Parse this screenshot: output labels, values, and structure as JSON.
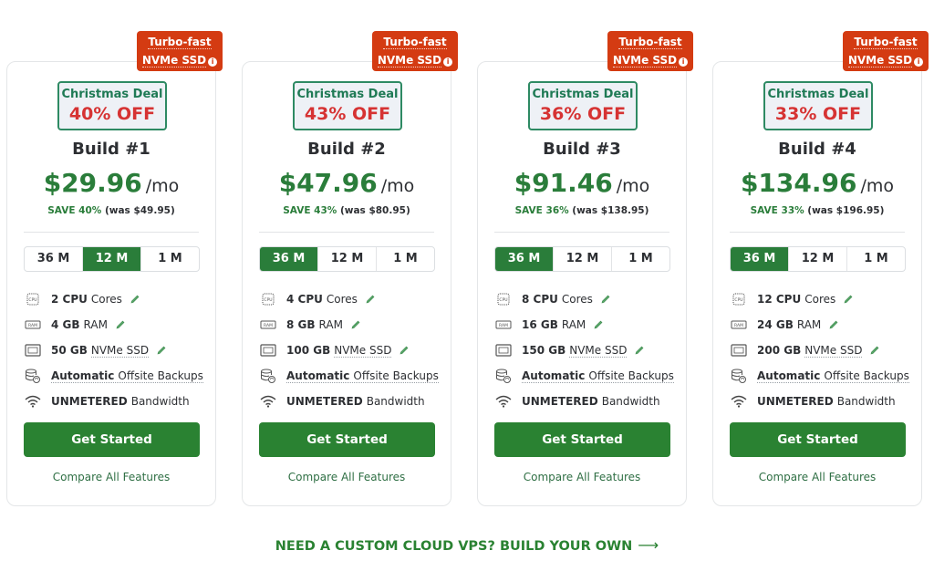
{
  "badge": {
    "line1": "Turbo-fast",
    "line2": "NVMe SSD",
    "icon": "info-icon"
  },
  "term_options": [
    "36 M",
    "12 M",
    "1 M"
  ],
  "plans": [
    {
      "deal_label": "Christmas Deal",
      "discount": "40% OFF",
      "name": "Build #1",
      "price": "$29.96",
      "period": "/mo",
      "save": "SAVE 40%",
      "was": "(was $49.95)",
      "selected_term": "12 M",
      "features": {
        "cpu": {
          "value": "2 CPU",
          "label": "Cores"
        },
        "ram": {
          "value": "4 GB",
          "label": "RAM"
        },
        "ssd": {
          "value": "50 GB",
          "label": "NVMe SSD"
        },
        "backup": {
          "value": "Automatic",
          "label": "Offsite Backups"
        },
        "bandwidth": {
          "value": "UNMETERED",
          "label": "Bandwidth"
        }
      },
      "cta": "Get Started",
      "compare": "Compare All Features"
    },
    {
      "deal_label": "Christmas Deal",
      "discount": "43% OFF",
      "name": "Build #2",
      "price": "$47.96",
      "period": "/mo",
      "save": "SAVE 43%",
      "was": "(was $80.95)",
      "selected_term": "36 M",
      "features": {
        "cpu": {
          "value": "4 CPU",
          "label": "Cores"
        },
        "ram": {
          "value": "8 GB",
          "label": "RAM"
        },
        "ssd": {
          "value": "100 GB",
          "label": "NVMe SSD"
        },
        "backup": {
          "value": "Automatic",
          "label": "Offsite Backups"
        },
        "bandwidth": {
          "value": "UNMETERED",
          "label": "Bandwidth"
        }
      },
      "cta": "Get Started",
      "compare": "Compare All Features"
    },
    {
      "deal_label": "Christmas Deal",
      "discount": "36% OFF",
      "name": "Build #3",
      "price": "$91.46",
      "period": "/mo",
      "save": "SAVE 36%",
      "was": "(was $138.95)",
      "selected_term": "36 M",
      "features": {
        "cpu": {
          "value": "8 CPU",
          "label": "Cores"
        },
        "ram": {
          "value": "16 GB",
          "label": "RAM"
        },
        "ssd": {
          "value": "150 GB",
          "label": "NVMe SSD"
        },
        "backup": {
          "value": "Automatic",
          "label": "Offsite Backups"
        },
        "bandwidth": {
          "value": "UNMETERED",
          "label": "Bandwidth"
        }
      },
      "cta": "Get Started",
      "compare": "Compare All Features"
    },
    {
      "deal_label": "Christmas Deal",
      "discount": "33% OFF",
      "name": "Build #4",
      "price": "$134.96",
      "period": "/mo",
      "save": "SAVE 33%",
      "was": "(was $196.95)",
      "selected_term": "36 M",
      "features": {
        "cpu": {
          "value": "12 CPU",
          "label": "Cores"
        },
        "ram": {
          "value": "24 GB",
          "label": "RAM"
        },
        "ssd": {
          "value": "200 GB",
          "label": "NVMe SSD"
        },
        "backup": {
          "value": "Automatic",
          "label": "Offsite Backups"
        },
        "bandwidth": {
          "value": "UNMETERED",
          "label": "Bandwidth"
        }
      },
      "cta": "Get Started",
      "compare": "Compare All Features"
    }
  ],
  "custom_link": {
    "label": "NEED A CUSTOM CLOUD VPS? BUILD YOUR OWN",
    "arrow": "⟶"
  },
  "colors": {
    "brand_green": "#2a8232",
    "price_green": "#2a7d3a",
    "deal_border": "#2e8a63",
    "discount_red": "#d63333",
    "badge_red": "#d43b12"
  }
}
